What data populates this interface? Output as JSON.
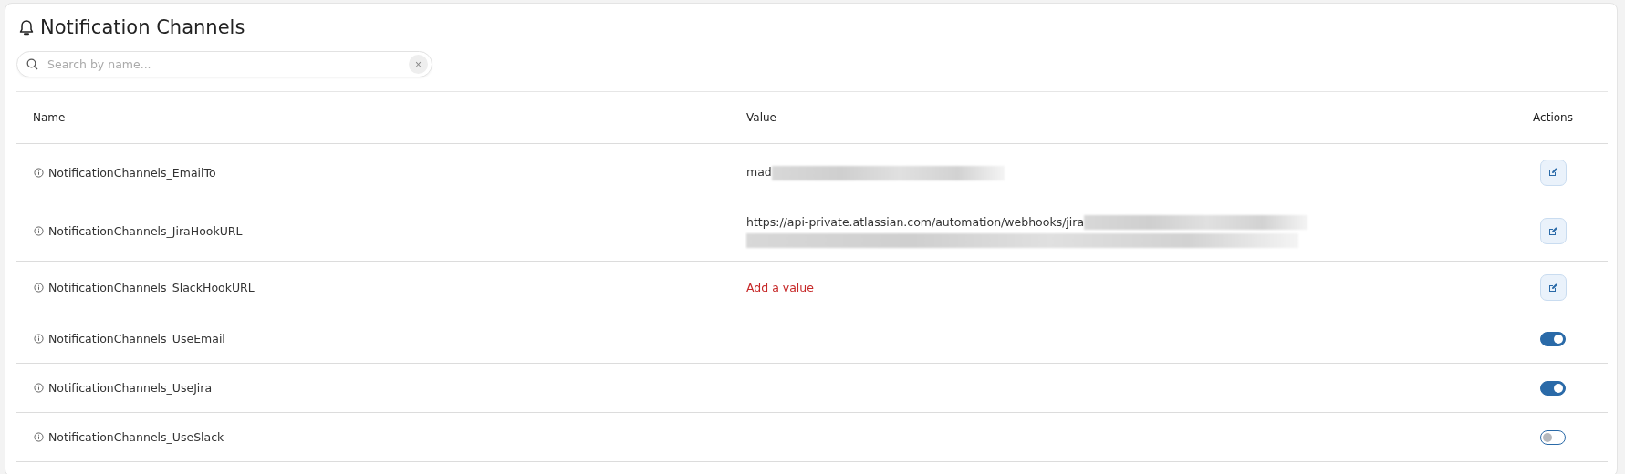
{
  "title": "Notification Channels",
  "search": {
    "placeholder": "Search by name...",
    "clear": "×"
  },
  "table": {
    "columns": [
      "Name",
      "Value",
      "Actions"
    ],
    "rows": [
      {
        "name": "NotificationChannels_EmailTo",
        "kind": "text",
        "value": "mad",
        "redacted": true,
        "redaction_wraps": false
      },
      {
        "name": "NotificationChannels_JiraHookURL",
        "kind": "text",
        "value": "https://api-private.atlassian.com/automation/webhooks/jira",
        "redacted": true,
        "redaction_wraps": true
      },
      {
        "name": "NotificationChannels_SlackHookURL",
        "kind": "empty",
        "value": "Add a value"
      },
      {
        "name": "NotificationChannels_UseEmail",
        "kind": "toggle",
        "on": true
      },
      {
        "name": "NotificationChannels_UseJira",
        "kind": "toggle",
        "on": true
      },
      {
        "name": "NotificationChannels_UseSlack",
        "kind": "toggle",
        "on": false
      }
    ]
  }
}
